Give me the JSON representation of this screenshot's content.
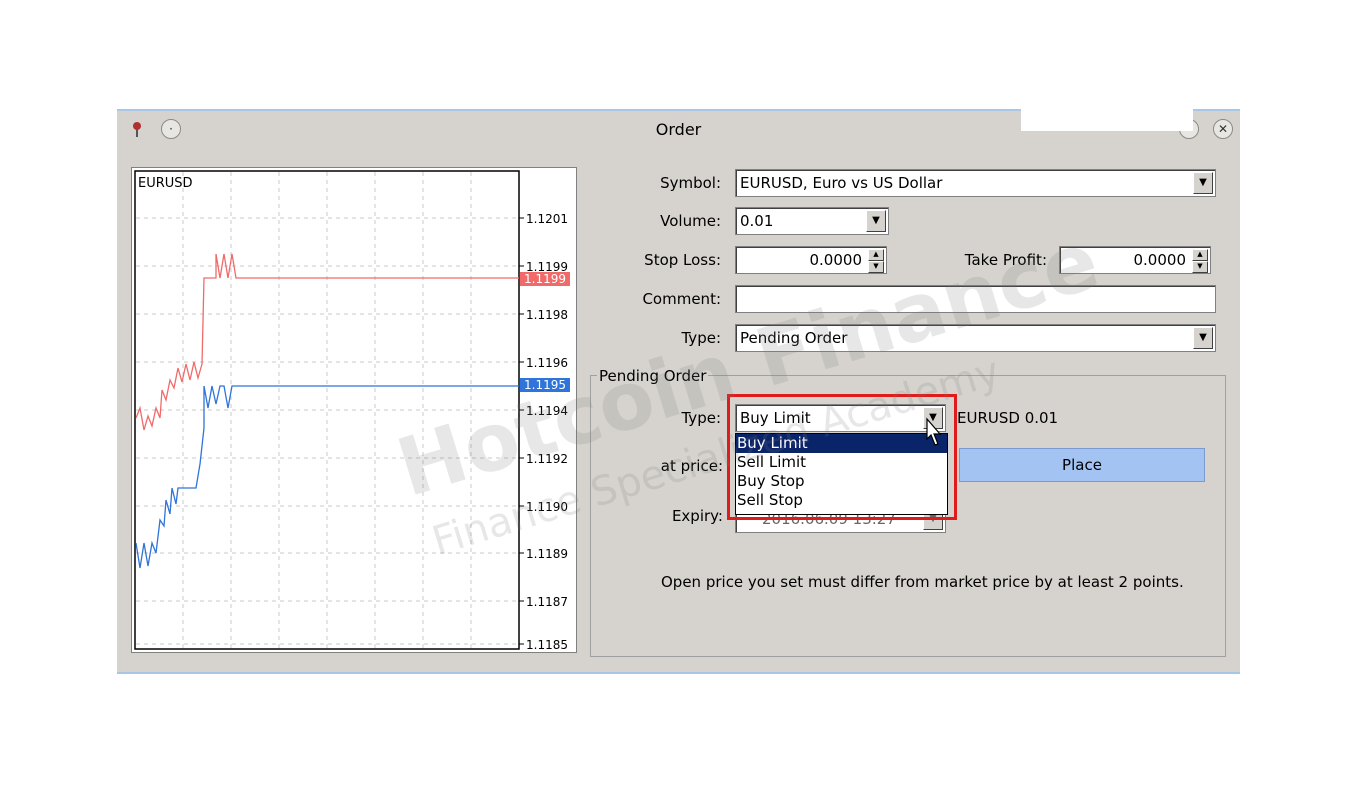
{
  "window": {
    "title": "Order",
    "close_glyph": "✕",
    "pin_glyph": "·"
  },
  "chart": {
    "symbol": "EURUSD",
    "price_labels": [
      "1.1201",
      "1.1199",
      "1.1198",
      "1.1196",
      "1.1195",
      "1.1194",
      "1.1192",
      "1.1190",
      "1.1189",
      "1.1187",
      "1.1185"
    ],
    "ask_tag": "1.1199",
    "bid_tag": "1.1195",
    "ask_color": "#f06a6a",
    "bid_color": "#2f74d8"
  },
  "form": {
    "symbol_label": "Symbol:",
    "symbol_value": "EURUSD, Euro vs US Dollar",
    "volume_label": "Volume:",
    "volume_value": "0.01",
    "stoploss_label": "Stop Loss:",
    "stoploss_value": "0.0000",
    "takeprofit_label": "Take Profit:",
    "takeprofit_value": "0.0000",
    "comment_label": "Comment:",
    "comment_value": "",
    "type_label": "Type:",
    "type_value": "Pending Order"
  },
  "pending": {
    "group_title": "Pending Order",
    "type_label": "Type:",
    "type_value": "Buy Limit",
    "symbol_volume": "EURUSD 0.01",
    "at_price_label": "at price:",
    "expiry_label": "Expiry:",
    "expiry_value": "2016.06.09 13:27",
    "place_label": "Place",
    "options": [
      "Buy Limit",
      "Sell Limit",
      "Buy Stop",
      "Sell Stop"
    ],
    "selected_option": "Buy Limit",
    "info_text": "Open price you set must differ from market price by at least 2 points."
  },
  "watermark": {
    "line1": "Hotcoin Finance",
    "line2": "Finance Specialized Academy"
  },
  "colors": {
    "highlight_box": "#e01b1b",
    "place_button": "#a3c4f3",
    "dropdown_selection": "#0a246a"
  }
}
